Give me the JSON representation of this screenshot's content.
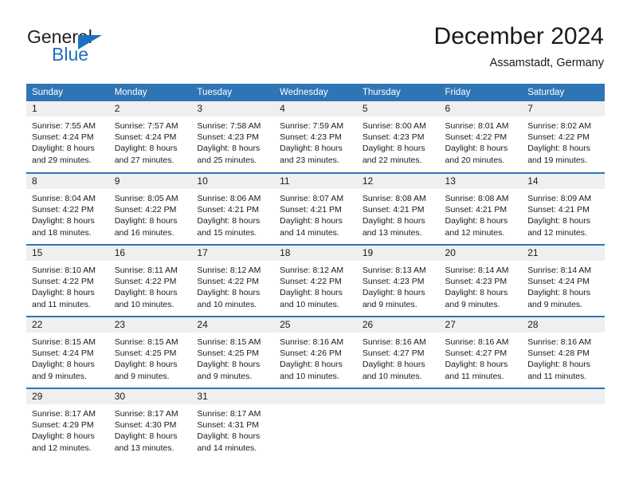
{
  "logo": {
    "text_dark": "General",
    "text_blue": "Blue",
    "triangle_color": "#1f6fc0"
  },
  "header": {
    "title": "December 2024",
    "subtitle": "Assamstadt, Germany",
    "accent_color": "#2e75b6",
    "daynum_bg": "#efefef"
  },
  "weekdays": [
    "Sunday",
    "Monday",
    "Tuesday",
    "Wednesday",
    "Thursday",
    "Friday",
    "Saturday"
  ],
  "weeks": [
    [
      {
        "day": "1",
        "sunrise": "Sunrise: 7:55 AM",
        "sunset": "Sunset: 4:24 PM",
        "daylight1": "Daylight: 8 hours",
        "daylight2": "and 29 minutes."
      },
      {
        "day": "2",
        "sunrise": "Sunrise: 7:57 AM",
        "sunset": "Sunset: 4:24 PM",
        "daylight1": "Daylight: 8 hours",
        "daylight2": "and 27 minutes."
      },
      {
        "day": "3",
        "sunrise": "Sunrise: 7:58 AM",
        "sunset": "Sunset: 4:23 PM",
        "daylight1": "Daylight: 8 hours",
        "daylight2": "and 25 minutes."
      },
      {
        "day": "4",
        "sunrise": "Sunrise: 7:59 AM",
        "sunset": "Sunset: 4:23 PM",
        "daylight1": "Daylight: 8 hours",
        "daylight2": "and 23 minutes."
      },
      {
        "day": "5",
        "sunrise": "Sunrise: 8:00 AM",
        "sunset": "Sunset: 4:23 PM",
        "daylight1": "Daylight: 8 hours",
        "daylight2": "and 22 minutes."
      },
      {
        "day": "6",
        "sunrise": "Sunrise: 8:01 AM",
        "sunset": "Sunset: 4:22 PM",
        "daylight1": "Daylight: 8 hours",
        "daylight2": "and 20 minutes."
      },
      {
        "day": "7",
        "sunrise": "Sunrise: 8:02 AM",
        "sunset": "Sunset: 4:22 PM",
        "daylight1": "Daylight: 8 hours",
        "daylight2": "and 19 minutes."
      }
    ],
    [
      {
        "day": "8",
        "sunrise": "Sunrise: 8:04 AM",
        "sunset": "Sunset: 4:22 PM",
        "daylight1": "Daylight: 8 hours",
        "daylight2": "and 18 minutes."
      },
      {
        "day": "9",
        "sunrise": "Sunrise: 8:05 AM",
        "sunset": "Sunset: 4:22 PM",
        "daylight1": "Daylight: 8 hours",
        "daylight2": "and 16 minutes."
      },
      {
        "day": "10",
        "sunrise": "Sunrise: 8:06 AM",
        "sunset": "Sunset: 4:21 PM",
        "daylight1": "Daylight: 8 hours",
        "daylight2": "and 15 minutes."
      },
      {
        "day": "11",
        "sunrise": "Sunrise: 8:07 AM",
        "sunset": "Sunset: 4:21 PM",
        "daylight1": "Daylight: 8 hours",
        "daylight2": "and 14 minutes."
      },
      {
        "day": "12",
        "sunrise": "Sunrise: 8:08 AM",
        "sunset": "Sunset: 4:21 PM",
        "daylight1": "Daylight: 8 hours",
        "daylight2": "and 13 minutes."
      },
      {
        "day": "13",
        "sunrise": "Sunrise: 8:08 AM",
        "sunset": "Sunset: 4:21 PM",
        "daylight1": "Daylight: 8 hours",
        "daylight2": "and 12 minutes."
      },
      {
        "day": "14",
        "sunrise": "Sunrise: 8:09 AM",
        "sunset": "Sunset: 4:21 PM",
        "daylight1": "Daylight: 8 hours",
        "daylight2": "and 12 minutes."
      }
    ],
    [
      {
        "day": "15",
        "sunrise": "Sunrise: 8:10 AM",
        "sunset": "Sunset: 4:22 PM",
        "daylight1": "Daylight: 8 hours",
        "daylight2": "and 11 minutes."
      },
      {
        "day": "16",
        "sunrise": "Sunrise: 8:11 AM",
        "sunset": "Sunset: 4:22 PM",
        "daylight1": "Daylight: 8 hours",
        "daylight2": "and 10 minutes."
      },
      {
        "day": "17",
        "sunrise": "Sunrise: 8:12 AM",
        "sunset": "Sunset: 4:22 PM",
        "daylight1": "Daylight: 8 hours",
        "daylight2": "and 10 minutes."
      },
      {
        "day": "18",
        "sunrise": "Sunrise: 8:12 AM",
        "sunset": "Sunset: 4:22 PM",
        "daylight1": "Daylight: 8 hours",
        "daylight2": "and 10 minutes."
      },
      {
        "day": "19",
        "sunrise": "Sunrise: 8:13 AM",
        "sunset": "Sunset: 4:23 PM",
        "daylight1": "Daylight: 8 hours",
        "daylight2": "and 9 minutes."
      },
      {
        "day": "20",
        "sunrise": "Sunrise: 8:14 AM",
        "sunset": "Sunset: 4:23 PM",
        "daylight1": "Daylight: 8 hours",
        "daylight2": "and 9 minutes."
      },
      {
        "day": "21",
        "sunrise": "Sunrise: 8:14 AM",
        "sunset": "Sunset: 4:24 PM",
        "daylight1": "Daylight: 8 hours",
        "daylight2": "and 9 minutes."
      }
    ],
    [
      {
        "day": "22",
        "sunrise": "Sunrise: 8:15 AM",
        "sunset": "Sunset: 4:24 PM",
        "daylight1": "Daylight: 8 hours",
        "daylight2": "and 9 minutes."
      },
      {
        "day": "23",
        "sunrise": "Sunrise: 8:15 AM",
        "sunset": "Sunset: 4:25 PM",
        "daylight1": "Daylight: 8 hours",
        "daylight2": "and 9 minutes."
      },
      {
        "day": "24",
        "sunrise": "Sunrise: 8:15 AM",
        "sunset": "Sunset: 4:25 PM",
        "daylight1": "Daylight: 8 hours",
        "daylight2": "and 9 minutes."
      },
      {
        "day": "25",
        "sunrise": "Sunrise: 8:16 AM",
        "sunset": "Sunset: 4:26 PM",
        "daylight1": "Daylight: 8 hours",
        "daylight2": "and 10 minutes."
      },
      {
        "day": "26",
        "sunrise": "Sunrise: 8:16 AM",
        "sunset": "Sunset: 4:27 PM",
        "daylight1": "Daylight: 8 hours",
        "daylight2": "and 10 minutes."
      },
      {
        "day": "27",
        "sunrise": "Sunrise: 8:16 AM",
        "sunset": "Sunset: 4:27 PM",
        "daylight1": "Daylight: 8 hours",
        "daylight2": "and 11 minutes."
      },
      {
        "day": "28",
        "sunrise": "Sunrise: 8:16 AM",
        "sunset": "Sunset: 4:28 PM",
        "daylight1": "Daylight: 8 hours",
        "daylight2": "and 11 minutes."
      }
    ],
    [
      {
        "day": "29",
        "sunrise": "Sunrise: 8:17 AM",
        "sunset": "Sunset: 4:29 PM",
        "daylight1": "Daylight: 8 hours",
        "daylight2": "and 12 minutes."
      },
      {
        "day": "30",
        "sunrise": "Sunrise: 8:17 AM",
        "sunset": "Sunset: 4:30 PM",
        "daylight1": "Daylight: 8 hours",
        "daylight2": "and 13 minutes."
      },
      {
        "day": "31",
        "sunrise": "Sunrise: 8:17 AM",
        "sunset": "Sunset: 4:31 PM",
        "daylight1": "Daylight: 8 hours",
        "daylight2": "and 14 minutes."
      },
      {
        "day": "",
        "sunrise": "",
        "sunset": "",
        "daylight1": "",
        "daylight2": ""
      },
      {
        "day": "",
        "sunrise": "",
        "sunset": "",
        "daylight1": "",
        "daylight2": ""
      },
      {
        "day": "",
        "sunrise": "",
        "sunset": "",
        "daylight1": "",
        "daylight2": ""
      },
      {
        "day": "",
        "sunrise": "",
        "sunset": "",
        "daylight1": "",
        "daylight2": ""
      }
    ]
  ]
}
